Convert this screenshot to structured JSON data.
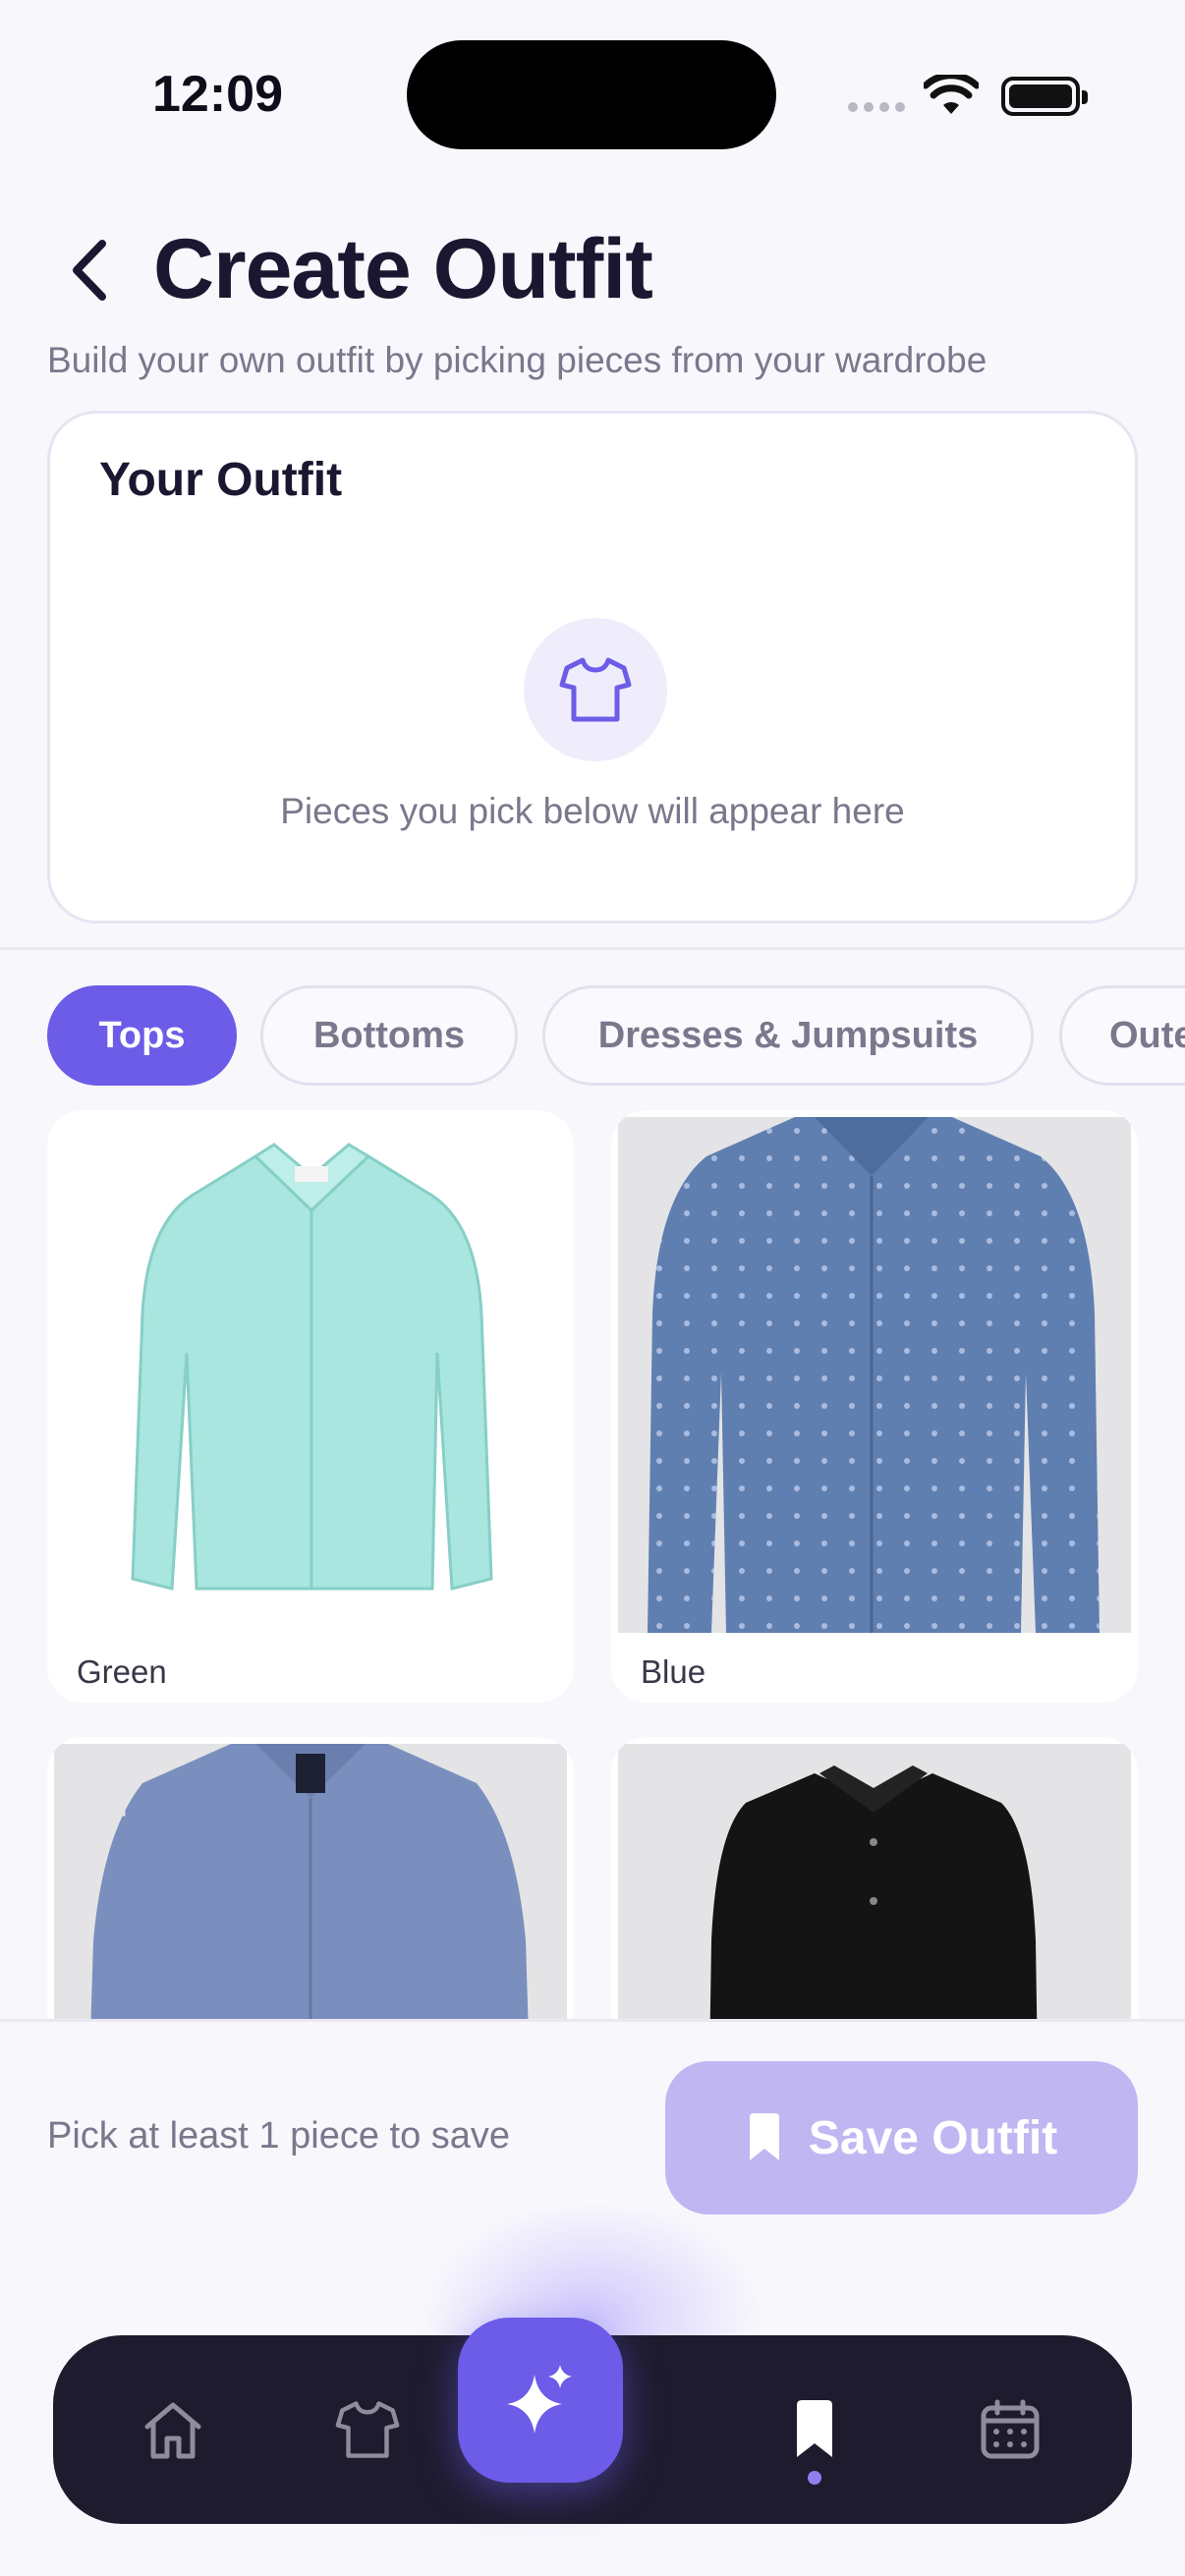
{
  "status_bar": {
    "time": "12:09"
  },
  "header": {
    "title": "Create Outfit",
    "subtitle": "Build your own outfit by picking pieces from your wardrobe"
  },
  "outfit_card": {
    "title": "Your Outfit",
    "empty_text": "Pieces you pick below will appear here",
    "icon": "shirt-icon"
  },
  "tabs": [
    {
      "label": "Tops",
      "active": true
    },
    {
      "label": "Bottoms",
      "active": false
    },
    {
      "label": "Dresses & Jumpsuits",
      "active": false
    },
    {
      "label": "Outerwear",
      "active": false
    }
  ],
  "items": [
    {
      "label": "Green",
      "shirt_color": "#a9e6df"
    },
    {
      "label": "Blue",
      "shirt_color": "#5f7fb0"
    },
    {
      "label": "",
      "shirt_color": "#7a8fbd"
    },
    {
      "label": "",
      "shirt_color": "#141414"
    }
  ],
  "save_bar": {
    "hint": "Pick at least 1 piece to save",
    "button_label": "Save Outfit"
  },
  "nav": {
    "items": [
      "home-icon",
      "shirt-icon",
      "sparkles-icon",
      "bookmark-icon",
      "calendar-icon"
    ],
    "active": "bookmark-icon"
  },
  "colors": {
    "accent": "#6c5ce7",
    "accent_disabled": "#c0b6f2",
    "nav_bg": "#1e1b2e",
    "background": "#f8f7fc"
  }
}
